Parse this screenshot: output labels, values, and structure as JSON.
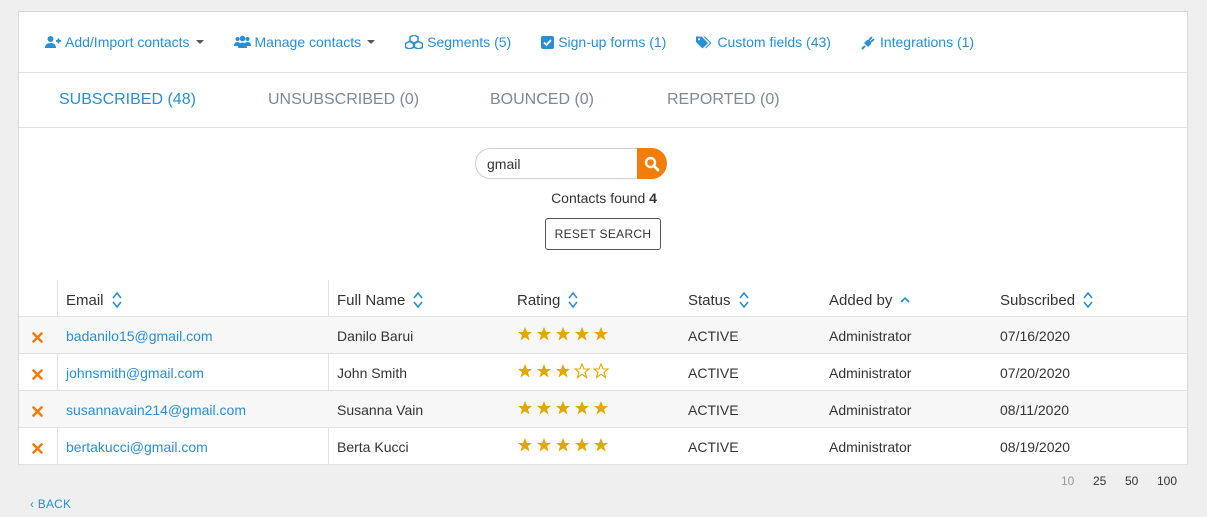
{
  "toolbar": {
    "add_import": "Add/Import contacts",
    "manage": "Manage contacts",
    "segments": "Segments (5)",
    "signup_forms": "Sign-up forms (1)",
    "custom_fields": "Custom fields (43)",
    "integrations": "Integrations (1)"
  },
  "tabs": [
    {
      "label": "SUBSCRIBED (48)",
      "active": true
    },
    {
      "label": "UNSUBSCRIBED (0)",
      "active": false
    },
    {
      "label": "BOUNCED (0)",
      "active": false
    },
    {
      "label": "REPORTED (0)",
      "active": false
    }
  ],
  "search": {
    "value": "gmail",
    "found_label": "Contacts found",
    "found_count": "4",
    "reset_label": "RESET SEARCH"
  },
  "table": {
    "headers": {
      "email": "Email",
      "full_name": "Full Name",
      "rating": "Rating",
      "status": "Status",
      "added_by": "Added by",
      "subscribed": "Subscribed"
    },
    "rows": [
      {
        "email": "badanilo15@gmail.com",
        "name": "Danilo Barui",
        "rating": 5,
        "status": "ACTIVE",
        "added_by": "Administrator",
        "subscribed": "07/16/2020"
      },
      {
        "email": "johnsmith@gmail.com",
        "name": "John Smith",
        "rating": 3,
        "status": "ACTIVE",
        "added_by": "Administrator",
        "subscribed": "07/20/2020"
      },
      {
        "email": "susannavain214@gmail.com",
        "name": "Susanna Vain",
        "rating": 5,
        "status": "ACTIVE",
        "added_by": "Administrator",
        "subscribed": "08/11/2020"
      },
      {
        "email": "bertakucci@gmail.com",
        "name": "Berta Kucci",
        "rating": 5,
        "status": "ACTIVE",
        "added_by": "Administrator",
        "subscribed": "08/19/2020"
      }
    ]
  },
  "pager": {
    "options": [
      "10",
      "25",
      "50",
      "100"
    ],
    "current": "10"
  },
  "back_label": "BACK",
  "colors": {
    "accent": "#2a8ed6",
    "search_button": "#f07d0c",
    "star": "#e0a800",
    "delete": "#f07d0c"
  }
}
